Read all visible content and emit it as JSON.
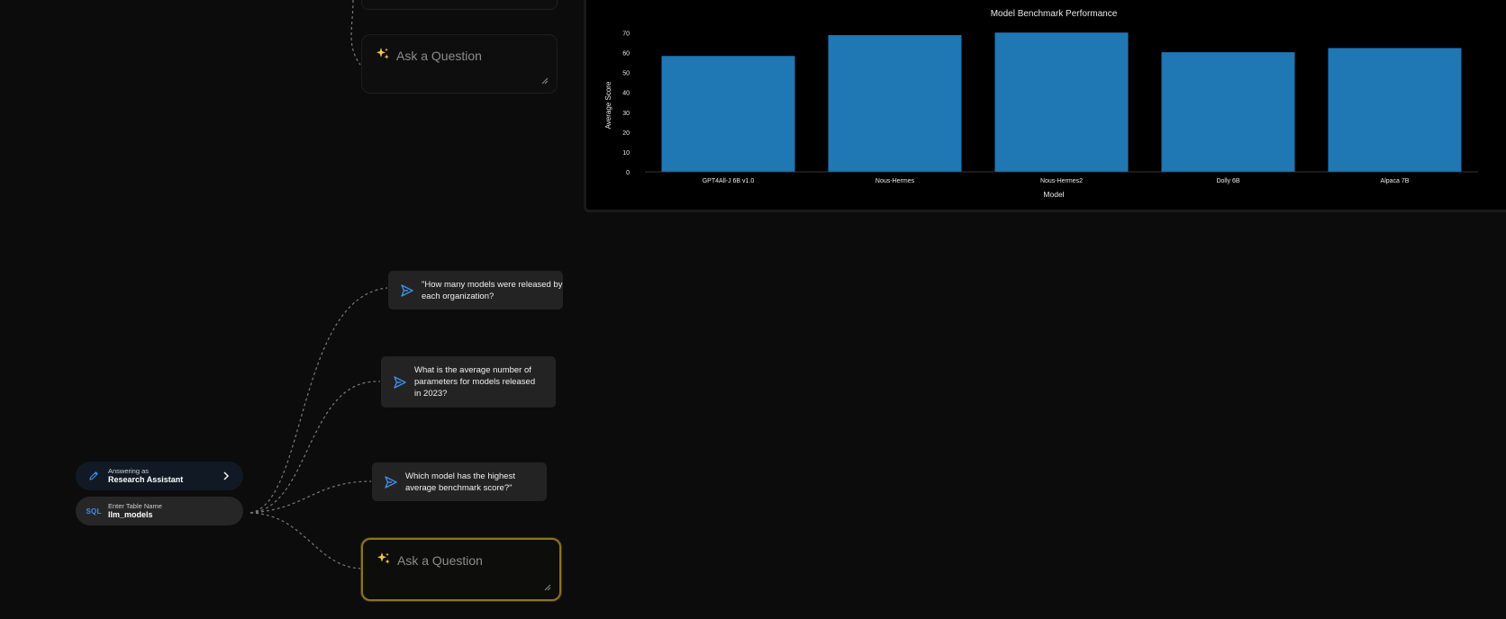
{
  "canvas": {
    "top_ask": {
      "placeholder": "Ask a Question"
    },
    "bottom_ask": {
      "placeholder": "Ask a Question"
    },
    "suggestions": [
      {
        "text": "\"How many models were released by each organization?"
      },
      {
        "text": "What is the average number of parameters for models released in 2023?"
      },
      {
        "text": "Which model has the highest average benchmark score?\""
      }
    ],
    "answering_pill": {
      "label": "Answering as",
      "value": "Research Assistant"
    },
    "table_pill": {
      "tag": "SQL",
      "label": "Enter Table Name",
      "value": "llm_models"
    }
  },
  "icons": {
    "sparkle": "sparkle-icon",
    "send": "send-icon",
    "pen": "pen-icon",
    "chevron": "chevron-right-icon",
    "resize": "resize-handle-icon"
  },
  "colors": {
    "background": "#0c0c0c",
    "bar": "#1f77b4",
    "sparkle": "#f2c94c",
    "accent_blue": "#3d8fe8",
    "active_border": "#8a7420"
  },
  "chart_data": {
    "type": "bar",
    "title": "Model Benchmark Performance",
    "xlabel": "Model",
    "ylabel": "Average Score",
    "categories": [
      "GPT4All-J 6B v1.0",
      "Nous-Hermes",
      "Nous-Hermes2",
      "Dolly 6B",
      "Alpaca 7B"
    ],
    "values": [
      58.3,
      68.8,
      70.1,
      60.2,
      62.3
    ],
    "yticks": [
      0,
      10,
      20,
      30,
      40,
      50,
      60,
      70
    ],
    "ylim": [
      0,
      72
    ],
    "grid": false,
    "legend": "none"
  }
}
